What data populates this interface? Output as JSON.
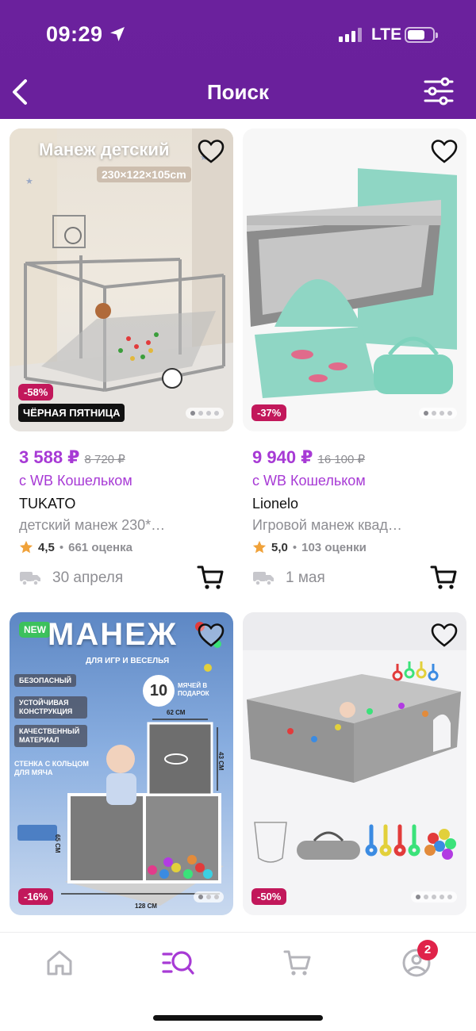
{
  "status_bar": {
    "time": "09:29",
    "network": "LTE",
    "battery_level": 0.7
  },
  "header": {
    "title": "Поиск"
  },
  "colors": {
    "header_bg": "#6b219d",
    "accent": "#a73ad5",
    "discount": "#c2185b",
    "new_badge": "#3cc15d",
    "cart_badge": "#e0234a"
  },
  "products": [
    {
      "image_title": "Манеж детский",
      "image_size": "230×122×105cm",
      "discount": "-58%",
      "promo": "ЧЁРНАЯ ПЯТНИЦА",
      "price": "3 588 ₽",
      "old_price": "8 720 ₽",
      "wallet": "с WB Кошельком",
      "brand": "TUKATO",
      "name": "детский манеж 230*…",
      "rating": "4,5",
      "reviews": "661 оценка",
      "delivery": "30 апреля"
    },
    {
      "discount": "-37%",
      "price": "9 940 ₽",
      "old_price": "16 100 ₽",
      "wallet": "с WB Кошельком",
      "brand": "Lionelo",
      "name": "Игровой манеж квад…",
      "rating": "5,0",
      "reviews": "103 оценки",
      "delivery": "1 мая"
    },
    {
      "new_label": "NEW",
      "image_title": "МАНЕЖ",
      "image_subtitle": "ДЛЯ ИГР И ВЕСЕЛЬЯ",
      "gift_number": "10",
      "gift_text": "МЯЧЕЙ В ПОДАРОК",
      "features": [
        "БЕЗОПАСНЫЙ",
        "УСТОЙЧИВАЯ КОНСТРУКЦИЯ",
        "КАЧЕСТВЕННЫЙ МАТЕРИАЛ",
        "СТЕНКА С КОЛЬЦОМ ДЛЯ МЯЧА"
      ],
      "dim_top": "62 СМ",
      "dim_side": "43 СМ",
      "dim_height": "65 СМ",
      "dim_bottom": "128 СМ",
      "discount": "-16%"
    },
    {
      "discount": "-50%"
    }
  ],
  "tab_bar": {
    "cart_badge": "2",
    "active": "search"
  }
}
